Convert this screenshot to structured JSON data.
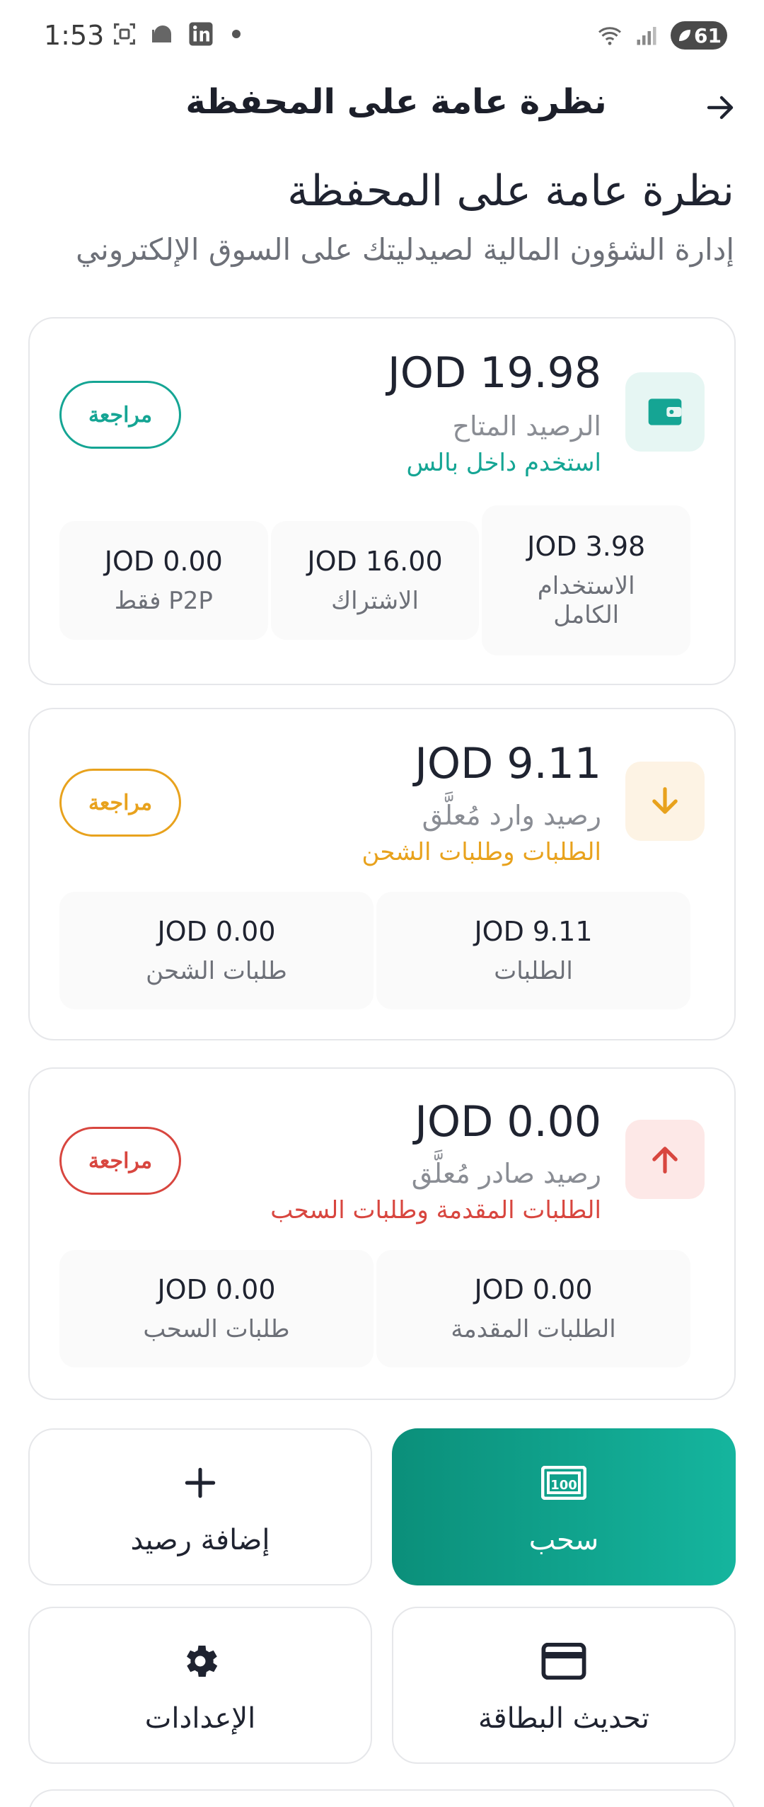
{
  "status_bar": {
    "time": "1:53",
    "battery": "61"
  },
  "app_bar": {
    "title": "نظرة عامة على المحفظة"
  },
  "header": {
    "title": "نظرة عامة على المحفظة",
    "subtitle": "إدارة الشؤون المالية لصيدليتك على السوق الإلكتروني"
  },
  "cards": {
    "available": {
      "amount": "JOD 19.98",
      "label": "الرصيد المتاح",
      "note": "استخدم داخل بالس",
      "review": "مراجعة",
      "accent": "#15a594",
      "icon_bg": "#e6f6f3",
      "breakdown": [
        {
          "amount": "JOD 3.98",
          "label": "الاستخدام الكامل"
        },
        {
          "amount": "JOD 16.00",
          "label": "الاشتراك"
        },
        {
          "amount": "JOD 0.00",
          "label": "P2P فقط"
        }
      ]
    },
    "incoming": {
      "amount": "JOD 9.11",
      "label": "رصيد وارد مُعلَّق",
      "note": "الطلبات وطلبات الشحن",
      "review": "مراجعة",
      "accent": "#e8a21d",
      "icon_bg": "#fdf3e4",
      "breakdown": [
        {
          "amount": "JOD 9.11",
          "label": "الطلبات"
        },
        {
          "amount": "JOD 0.00",
          "label": "طلبات الشحن"
        }
      ]
    },
    "outgoing": {
      "amount": "JOD 0.00",
      "label": "رصيد صادر مُعلَّق",
      "note": "الطلبات المقدمة وطلبات السحب",
      "review": "مراجعة",
      "accent": "#d8463f",
      "icon_bg": "#fde8e7",
      "breakdown": [
        {
          "amount": "JOD 0.00",
          "label": "الطلبات المقدمة"
        },
        {
          "amount": "JOD 0.00",
          "label": "طلبات السحب"
        }
      ]
    }
  },
  "actions": {
    "withdraw": "سحب",
    "add_balance": "إضافة رصيد",
    "update_card": "تحديث البطاقة",
    "settings": "الإعدادات"
  }
}
